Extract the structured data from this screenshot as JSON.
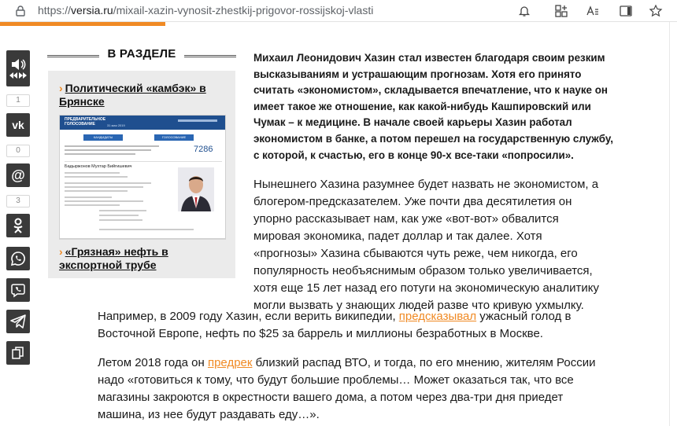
{
  "browser": {
    "url_scheme": "https://",
    "url_host": "versia.ru",
    "url_path": "/mixail-xazin-vynosit-zhestkij-prigovor-rossijskoj-vlasti",
    "toolbar_icons": [
      "lock-icon",
      "bell-icon",
      "add-tab-icon",
      "reader-icon",
      "sidebar-icon",
      "star-icon"
    ]
  },
  "share": {
    "counts": {
      "vk": "1",
      "mail": "0",
      "ok": "3"
    },
    "buttons": [
      "sound",
      "vk",
      "mail",
      "odnoklassniki",
      "whatsapp",
      "viber",
      "telegram",
      "copy"
    ]
  },
  "sidebar": {
    "heading": "В РАЗДЕЛЕ",
    "items": [
      {
        "title": "Политический «камбэк» в Брянске"
      },
      {
        "title": "«Грязная» нефть в экспортной трубе"
      }
    ],
    "thumb": {
      "header": "ПРЕДВАРИТЕЛЬНОЕ ГОЛОСОВАНИЕ",
      "date": "31 мая 2019",
      "btn1": "КАНДИДАТЫ",
      "btn2": "ГОЛОСОВАНИЕ",
      "counter": "7286",
      "person": "Бадыржонов Мухтар Бийгишевич"
    }
  },
  "article": {
    "lead": "Михаил Леонидович Хазин стал известен благодаря своим резким высказываниям и устрашающим прогнозам. Хотя его принято считать «экономистом», складывается впечатление, что к науке он имеет такое же отношение, как какой-нибудь Кашпировский или Чумак – к медицине. В начале своей карьеры Хазин работал экономистом в банке, а потом перешел на государственную службу, с которой, к счастью, его в конце 90-х все-таки «попросили».",
    "p1": "Нынешнего Хазина разумнее будет назвать не экономистом, а блогером-предсказателем. Уже почти два десятилетия он упорно рассказывает нам, как уже «вот-вот» обвалится мировая экономика, падет доллар и так далее. Хотя «прогнозы» Хазина сбываются чуть реже, чем никогда, его популярность необъяснимым образом только увеличивается, хотя еще 15 лет назад его потуги на экономическую аналитику могли вызвать у знающих людей разве что кривую ухмылку.",
    "p2_before": "Например, в 2009 году Хазин, если верить википедии, ",
    "p2_link": "предсказывал",
    "p2_after": " ужасный голод в Восточной Европе, нефть по $25 за баррель и миллионы безработных в Москве.",
    "p3_before": "Летом 2018 года он ",
    "p3_link": "предрек",
    "p3_after": " близкий распад ВТО, и тогда, по его мнению, жителям России надо «готовиться к тому, что будут большие проблемы… Может оказаться так, что все магазины закроются в окрестности вашего дома, а потом через два-три дня приедет машина, из нее будут раздавать еду…»."
  },
  "colors": {
    "accent": "#f08a24",
    "share_bg": "#3a3a3a",
    "sidebar_bg": "#ebebeb"
  }
}
